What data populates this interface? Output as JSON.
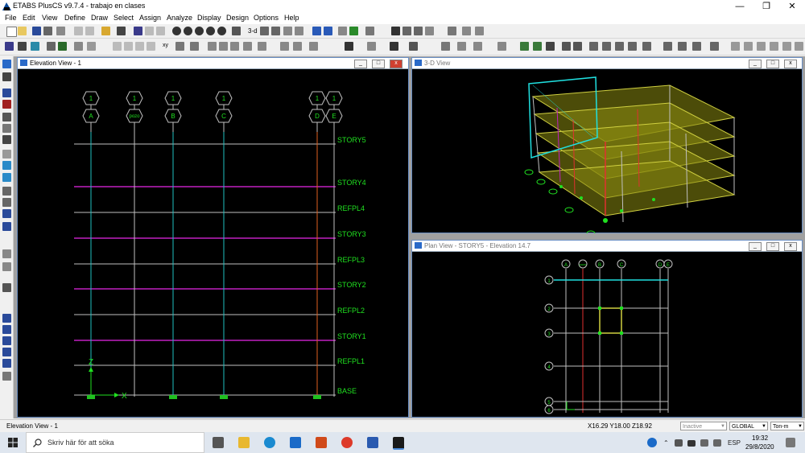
{
  "app": {
    "title": "ETABS PlusCS v9.7.4 - trabajo en clases",
    "win_minimize": "—",
    "win_restore": "❐",
    "win_close": "✕"
  },
  "menu": [
    "File",
    "Edit",
    "View",
    "Define",
    "Draw",
    "Select",
    "Assign",
    "Analyze",
    "Display",
    "Design",
    "Options",
    "Help"
  ],
  "toolbar": {
    "view_3d_label": "3-d",
    "xy_label": "xy"
  },
  "elevation_view": {
    "title": "Elevation View - 1",
    "gridlines": [
      {
        "top": "1",
        "bottom": "A"
      },
      {
        "top": "1",
        "bottom": "pozo"
      },
      {
        "top": "1",
        "bottom": "B"
      },
      {
        "top": "1",
        "bottom": "C"
      },
      {
        "top": "1",
        "bottom": "D"
      },
      {
        "top": "1",
        "bottom": "E"
      }
    ],
    "stories": [
      "STORY5",
      "STORY4",
      "REFPL4",
      "STORY3",
      "REFPL3",
      "STORY2",
      "REFPL2",
      "STORY1",
      "REFPL1",
      "BASE"
    ],
    "axis_z": "Z",
    "axis_x": "X"
  },
  "view_3d": {
    "title": "3-D View"
  },
  "plan_view": {
    "title": "Plan View - STORY5 - Elevation 14.7",
    "col_bubbles": [
      "A",
      "pozo",
      "B",
      "C",
      "D",
      "E"
    ],
    "row_bubbles": [
      "1",
      "2",
      "3",
      "4",
      "5",
      "6"
    ]
  },
  "status": {
    "active_view": "Elevation View - 1",
    "coords": "X16.29  Y18.00  Z18.92",
    "mode_select": "Inactive",
    "coord_system": "GLOBAL",
    "units": "Ton-m"
  },
  "taskbar": {
    "search_placeholder": "Skriv här för att söka",
    "language": "ESP",
    "time": "19:32",
    "date": "29/8/2020"
  }
}
